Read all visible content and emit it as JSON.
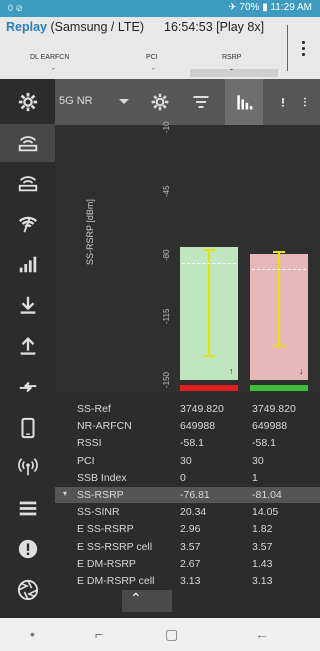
{
  "statusbar": {
    "left": "0 ⊘",
    "right": "✈ 70% ▮ 11:29 AM"
  },
  "appbar": {
    "replay": "Replay",
    "source": "(Samsung / LTE)",
    "time": "16:54:53 [Play 8x]",
    "col1": "DL EARFCN",
    "col2": "PCI",
    "col3": "RSRP",
    "val1": "-",
    "val2": "-",
    "val3": "-"
  },
  "toolbar": {
    "selector": "5G NR"
  },
  "chart_data": {
    "type": "bar",
    "ylabel": "SS-RSRP [dBm]",
    "yticks": [
      "-10",
      "-45",
      "-80",
      "-115",
      "-150"
    ],
    "ylim": [
      -150,
      -10
    ],
    "categories": [
      "0",
      "1"
    ],
    "values": [
      -76.81,
      -81.04
    ],
    "bar_colors": [
      "#bfe6bf",
      "#e8b8b8"
    ],
    "indicator_colors": [
      "#e02020",
      "#3cc03c"
    ],
    "ranges": [
      [
        -78,
        -136
      ],
      [
        -79,
        -131
      ]
    ],
    "dotted": [
      -86,
      -89
    ],
    "arrows": [
      "↑",
      "↓"
    ]
  },
  "table": {
    "rows": [
      {
        "label": "SS-Ref",
        "v1": "3749.820",
        "v2": "3749.820"
      },
      {
        "label": "NR-ARFCN",
        "v1": "649988",
        "v2": "649988"
      },
      {
        "label": "RSSI",
        "v1": "-58.1",
        "v2": "-58.1"
      },
      {
        "label": "PCI",
        "v1": "30",
        "v2": "30"
      },
      {
        "label": "SSB Index",
        "v1": "0",
        "v2": "1"
      },
      {
        "label": "SS-RSRP",
        "v1": "-76.81",
        "v2": "-81.04"
      },
      {
        "label": "SS-SINR",
        "v1": "20.34",
        "v2": "14.05"
      },
      {
        "label": "E SS-RSRP",
        "v1": "2.96",
        "v2": "1.82"
      },
      {
        "label": "E SS-RSRP cell",
        "v1": "3.57",
        "v2": "3.57"
      },
      {
        "label": "E DM-RSRP",
        "v1": "2.67",
        "v2": "1.43"
      },
      {
        "label": "E DM-RSRP cell",
        "v1": "3.13",
        "v2": "3.13"
      }
    ],
    "selected_index": 5,
    "expand_marker": "▾"
  },
  "up_button": "⌃",
  "navbar": {
    "dot": "•",
    "recent": "⌐",
    "home": "▢",
    "back": "←"
  }
}
